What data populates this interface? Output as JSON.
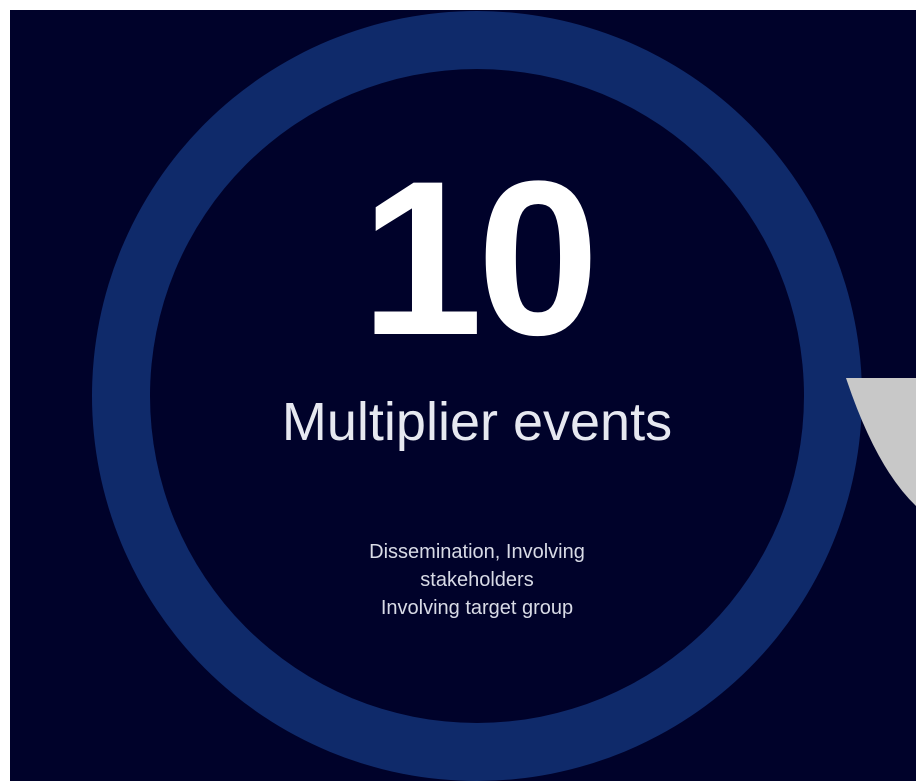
{
  "stat": {
    "number": "10",
    "title": "Multiplier events",
    "description_lines": [
      "Dissemination, Involving",
      "stakeholders",
      "Involving target group"
    ]
  },
  "colors": {
    "background": "#00022a",
    "ring": "#0f2a6a",
    "text": "#ffffff",
    "accent_shape": "#c8c8c8"
  }
}
